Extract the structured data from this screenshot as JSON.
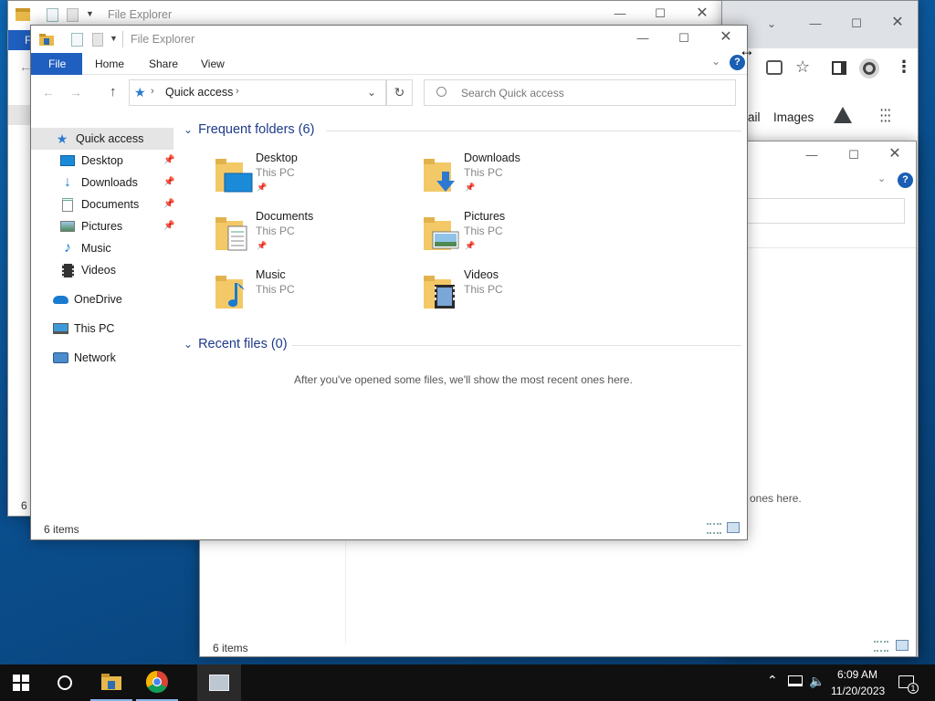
{
  "back_window": {
    "title": "File Explorer",
    "status_text": "6 i"
  },
  "browser": {
    "toolbar_links": [
      "ail",
      "Images"
    ]
  },
  "mid_window": {
    "recent_message_tail": "ones here.",
    "status_text": "6 items"
  },
  "main_window": {
    "title": "File Explorer",
    "ribbon_tabs": {
      "file": "File",
      "home": "Home",
      "share": "Share",
      "view": "View"
    },
    "address_path": "Quick access",
    "search_placeholder": "Search Quick access",
    "nav_pane": {
      "quick_access": "Quick access",
      "desktop": "Desktop",
      "downloads": "Downloads",
      "documents": "Documents",
      "pictures": "Pictures",
      "music": "Music",
      "videos": "Videos",
      "onedrive": "OneDrive",
      "this_pc": "This PC",
      "network": "Network"
    },
    "frequent_header": "Frequent folders (6)",
    "folders": [
      {
        "name": "Desktop",
        "location": "This PC"
      },
      {
        "name": "Downloads",
        "location": "This PC"
      },
      {
        "name": "Documents",
        "location": "This PC"
      },
      {
        "name": "Pictures",
        "location": "This PC"
      },
      {
        "name": "Music",
        "location": "This PC"
      },
      {
        "name": "Videos",
        "location": "This PC"
      }
    ],
    "recent_header": "Recent files (0)",
    "recent_empty_message": "After you've opened some files, we'll show the most recent ones here.",
    "status_text": "6 items"
  },
  "taskbar": {
    "time": "6:09 AM",
    "date": "11/20/2023",
    "notification_count": "1"
  },
  "colors": {
    "accent": "#1a5fb4",
    "file_tab": "#1f5fbf",
    "selection": "#e5e5e5",
    "taskbar": "#101010"
  }
}
